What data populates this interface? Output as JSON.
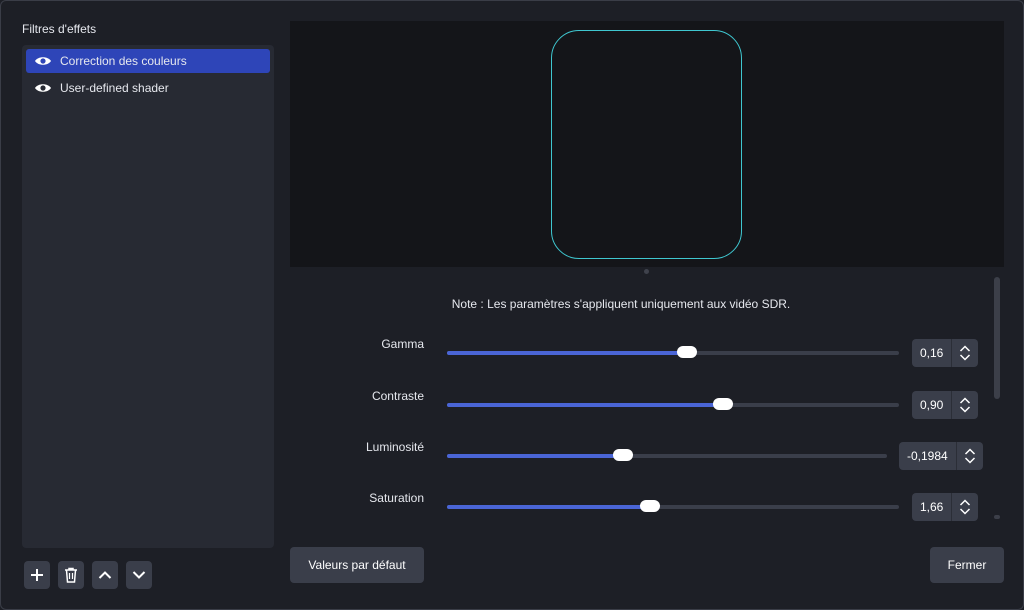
{
  "sidebar": {
    "title": "Filtres d'effets",
    "items": [
      {
        "label": "Correction des couleurs",
        "selected": true,
        "icon": "eye-icon"
      },
      {
        "label": "User-defined shader",
        "selected": false,
        "icon": "eye-icon"
      }
    ],
    "tools": [
      "add-icon",
      "trash-icon",
      "chevron-up-icon",
      "chevron-down-icon"
    ]
  },
  "preview": {
    "shape_color": "#3fc7d0"
  },
  "settings": {
    "note": "Note : Les paramètres s'appliquent uniquement aux vidéo SDR.",
    "params": [
      {
        "label": "Gamma",
        "value": "0,16",
        "level": 0.53
      },
      {
        "label": "Contraste",
        "value": "0,90",
        "level": 0.61
      },
      {
        "label": "Luminosité",
        "value": "-0,1984",
        "level": 0.4
      },
      {
        "label": "Saturation",
        "value": "1,66",
        "level": 0.45
      }
    ]
  },
  "buttons": {
    "defaults": "Valeurs par défaut",
    "close": "Fermer"
  },
  "colors": {
    "accent": "#2e45b8",
    "slider_fill": "#4a65d6",
    "background": "#1d1f26"
  }
}
